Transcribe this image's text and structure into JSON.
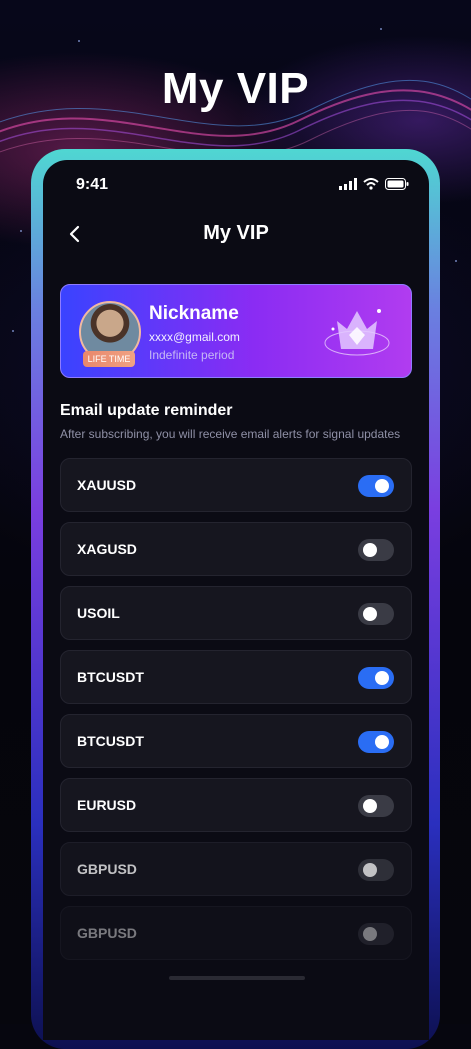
{
  "hero_title": "My VIP",
  "status": {
    "time": "9:41"
  },
  "nav": {
    "title": "My VIP"
  },
  "profile": {
    "nickname": "Nickname",
    "email": "xxxx@gmail.com",
    "period": "Indefinite period",
    "badge": "LIFE TIME"
  },
  "reminder": {
    "title": "Email update reminder",
    "subtitle": "After subscribing, you will receive email alerts for signal updates"
  },
  "symbols": [
    {
      "label": "XAUUSD",
      "enabled": true
    },
    {
      "label": "XAGUSD",
      "enabled": false
    },
    {
      "label": "USOIL",
      "enabled": false
    },
    {
      "label": "BTCUSDT",
      "enabled": true
    },
    {
      "label": "BTCUSDT",
      "enabled": true
    },
    {
      "label": "EURUSD",
      "enabled": false
    },
    {
      "label": "GBPUSD",
      "enabled": false
    },
    {
      "label": "GBPUSD",
      "enabled": false
    }
  ],
  "colors": {
    "toggle_on": "#2a6df4",
    "toggle_off": "#3a3b45",
    "card_start": "#3a43ff",
    "card_end": "#b13cf0"
  }
}
